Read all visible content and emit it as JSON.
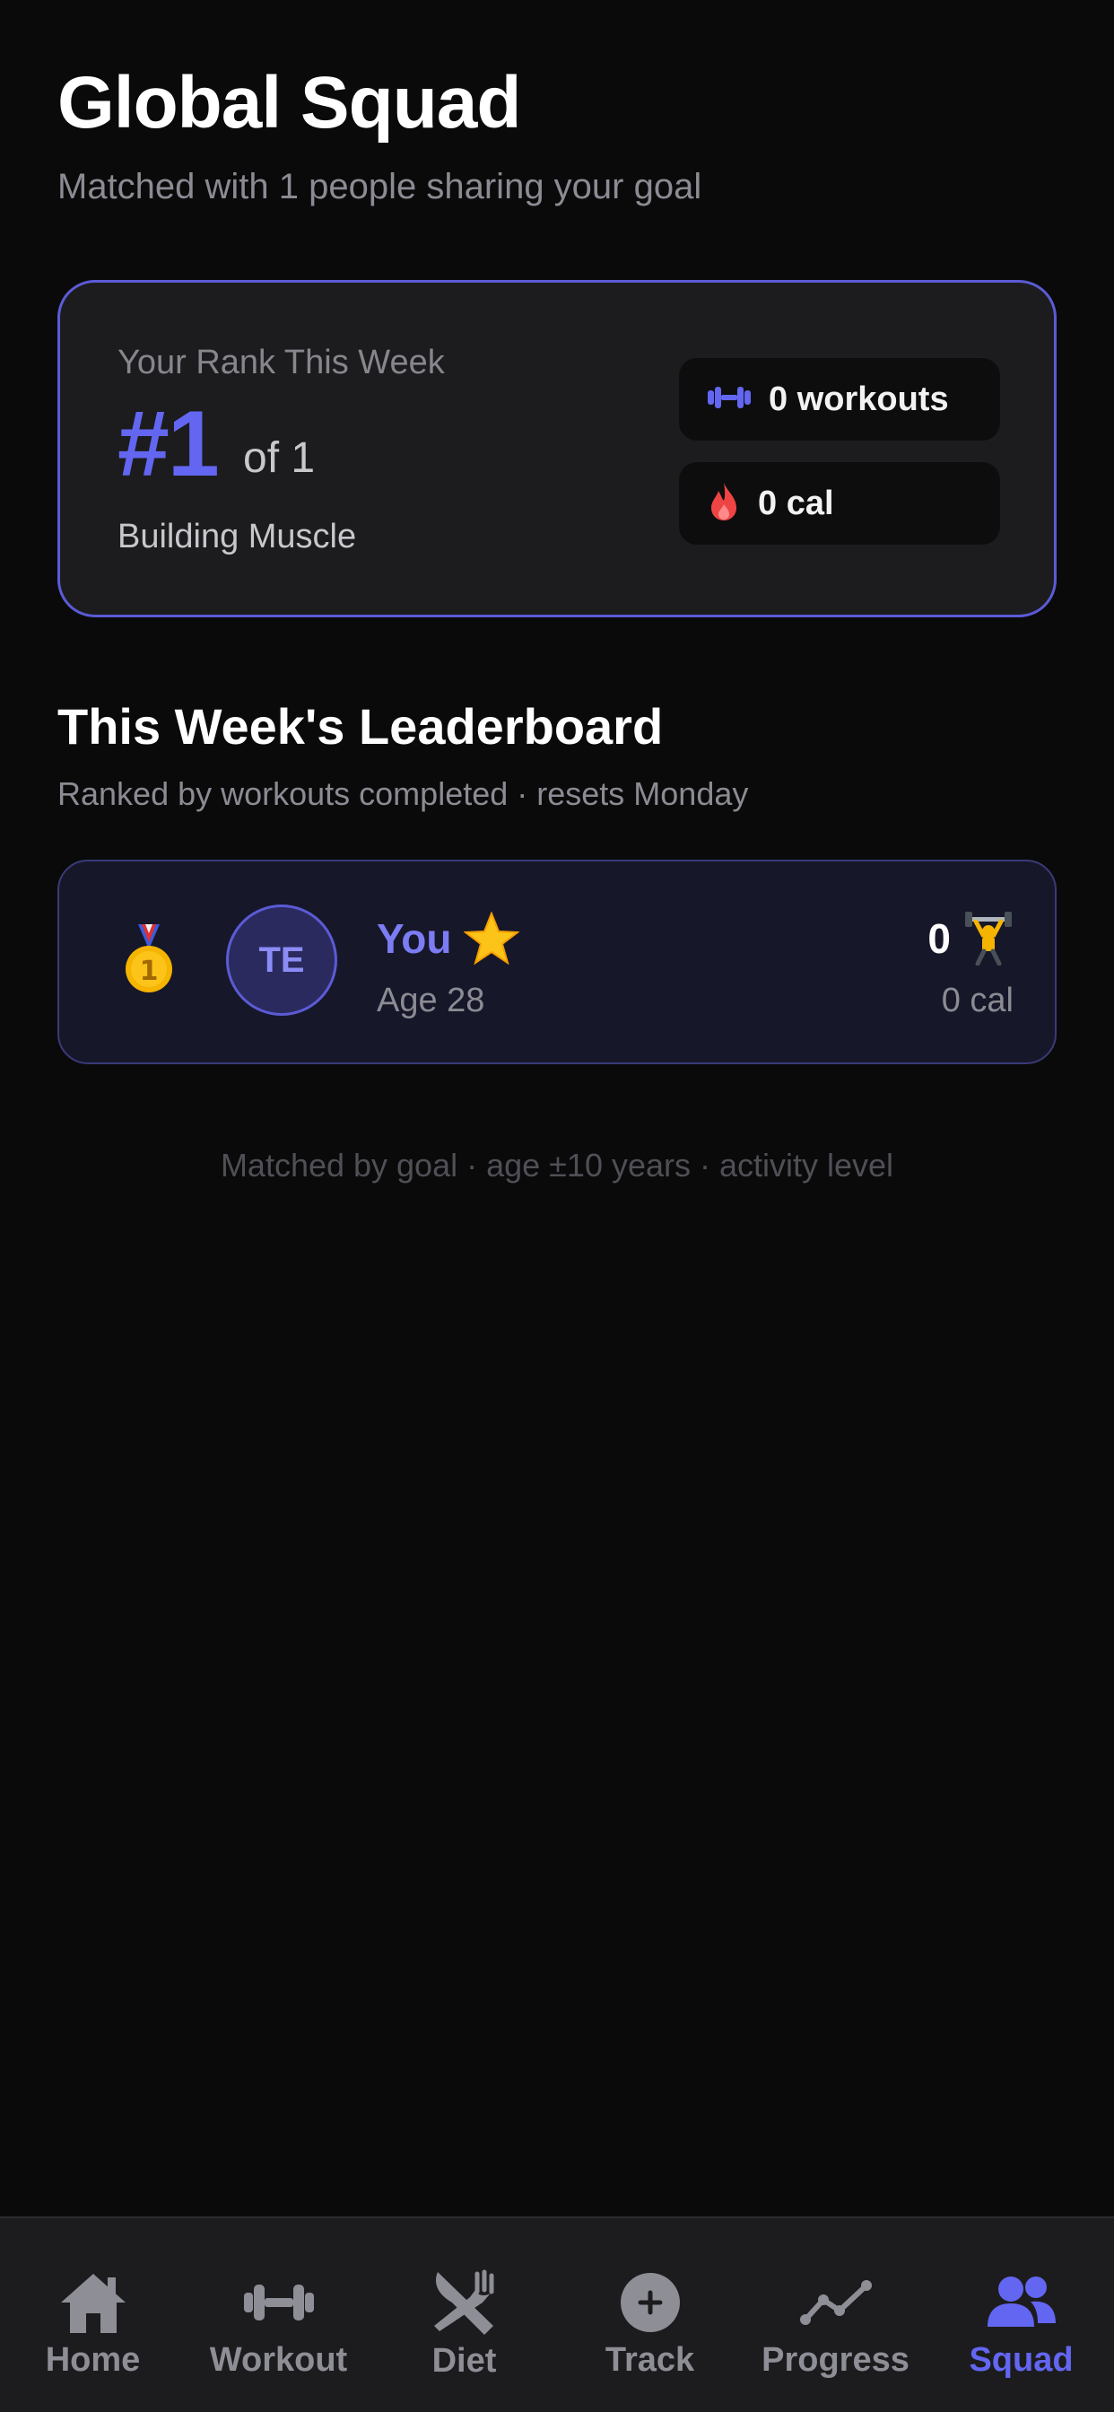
{
  "header": {
    "title": "Global Squad",
    "subtitle": "Matched with 1 people sharing your goal"
  },
  "rank_card": {
    "label": "Your Rank This Week",
    "rank": "#1",
    "of_total": "of 1",
    "goal": "Building Muscle",
    "workouts": "0 workouts",
    "calories": "0 cal",
    "icons": [
      "dumbbell-icon",
      "flame-icon"
    ]
  },
  "leaderboard": {
    "title": "This Week's Leaderboard",
    "subtitle": "Ranked by workouts completed · resets Monday",
    "entries": [
      {
        "place_icon": "gold-medal-icon",
        "initials": "TE",
        "name": "You",
        "badge_icon": "star-icon",
        "age": "Age 28",
        "score": "0",
        "score_icon": "weightlifter-icon",
        "calories": "0 cal"
      }
    ]
  },
  "footnote": "Matched by goal · age ±10 years · activity level",
  "nav": {
    "items": [
      {
        "label": "Home",
        "icon": "home-icon"
      },
      {
        "label": "Workout",
        "icon": "dumbbell-icon"
      },
      {
        "label": "Diet",
        "icon": "utensils-icon"
      },
      {
        "label": "Track",
        "icon": "plus-circle-icon"
      },
      {
        "label": "Progress",
        "icon": "trend-line-icon"
      },
      {
        "label": "Squad",
        "icon": "people-icon"
      }
    ],
    "active": "Squad"
  },
  "colors": {
    "accent": "#6366f1",
    "background": "#0a0a0b",
    "card": "#1c1c1e",
    "flame": "#ef4444",
    "gold": "#f5b400"
  }
}
